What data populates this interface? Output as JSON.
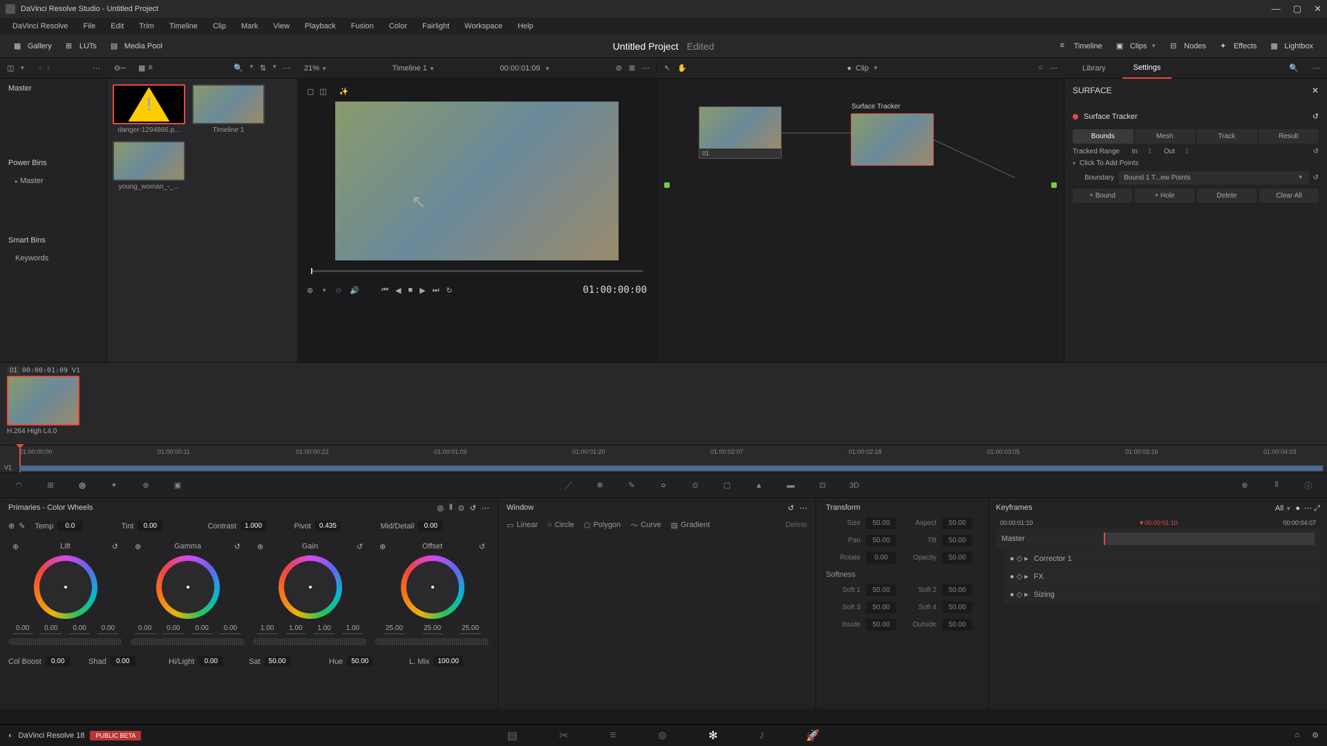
{
  "window": {
    "title": "DaVinci Resolve Studio - Untitled Project"
  },
  "menu": [
    "DaVinci Resolve",
    "File",
    "Edit",
    "Trim",
    "Timeline",
    "Clip",
    "Mark",
    "View",
    "Playback",
    "Fusion",
    "Color",
    "Fairlight",
    "Workspace",
    "Help"
  ],
  "toolbar": {
    "gallery": "Gallery",
    "luts": "LUTs",
    "mediapool": "Media Pool",
    "timeline": "Timeline",
    "clips": "Clips",
    "nodes": "Nodes",
    "effects": "Effects",
    "lightbox": "Lightbox"
  },
  "project": {
    "title": "Untitled Project",
    "status": "Edited"
  },
  "subbar": {
    "zoom": "21%",
    "timeline": "Timeline 1",
    "tc": "00:00:01:09",
    "clip": "Clip"
  },
  "sidebar": {
    "master": "Master",
    "powerbins": "Power Bins",
    "pb_master": "Master",
    "smartbins": "Smart Bins",
    "keywords": "Keywords"
  },
  "thumbs": [
    {
      "name": "danger-1294866.p...",
      "type": "warning"
    },
    {
      "name": "Timeline 1",
      "type": "clip"
    },
    {
      "name": "young_woman_-_...",
      "type": "clip"
    }
  ],
  "viewer": {
    "tc": "01:00:00:00"
  },
  "nodes": {
    "label1": "01",
    "surface_label": "Surface Tracker"
  },
  "inspector": {
    "tabs": {
      "library": "Library",
      "settings": "Settings"
    },
    "section": "SURFACE",
    "tracker": "Surface Tracker",
    "pills": [
      "Bounds",
      "Mesh",
      "Track",
      "Result"
    ],
    "tracked_range": "Tracked Range",
    "in": "In",
    "in_v": "1",
    "out": "Out",
    "out_v": "1",
    "click_points": "Click To Add Points",
    "boundary": "Boundary",
    "boundary_v": "Bound 1 T...ew Points",
    "btns": [
      "+ Bound",
      "+ Hole",
      "Delete",
      "Clear All"
    ]
  },
  "clip": {
    "id": "01",
    "tc": "00:00:01:09",
    "track": "V1",
    "codec": "H.264 High L4.0"
  },
  "ruler": [
    "01:00:00:00",
    "01:00:00:11",
    "01:00:00:22",
    "01:00:01:09",
    "01:00:01:20",
    "01:00:02:07",
    "01:00:02:18",
    "01:00:03:05",
    "01:00:03:16",
    "01:00:04:03"
  ],
  "ruler_track": "V1",
  "primaries": {
    "title": "Primaries - Color Wheels",
    "top": {
      "temp": "Temp",
      "temp_v": "0.0",
      "tint": "Tint",
      "tint_v": "0.00",
      "contrast": "Contrast",
      "contrast_v": "1.000",
      "pivot": "Pivot",
      "pivot_v": "0.435",
      "md": "Mid/Detail",
      "md_v": "0.00"
    },
    "wheels": [
      {
        "name": "Lift",
        "vals": [
          "0.00",
          "0.00",
          "0.00",
          "0.00"
        ]
      },
      {
        "name": "Gamma",
        "vals": [
          "0.00",
          "0.00",
          "0.00",
          "0.00"
        ]
      },
      {
        "name": "Gain",
        "vals": [
          "1.00",
          "1.00",
          "1.00",
          "1.00"
        ]
      },
      {
        "name": "Offset",
        "vals": [
          "25.00",
          "25.00",
          "25.00"
        ]
      }
    ],
    "bot": {
      "cb": "Col Boost",
      "cb_v": "0.00",
      "shad": "Shad",
      "shad_v": "0.00",
      "hl": "Hi/Light",
      "hl_v": "0.00",
      "sat": "Sat",
      "sat_v": "50.00",
      "hue": "Hue",
      "hue_v": "50.00",
      "lm": "L. Mix",
      "lm_v": "100.00"
    }
  },
  "window_p": {
    "title": "Window",
    "shapes": [
      "Linear",
      "Circle",
      "Polygon",
      "Curve",
      "Gradient"
    ],
    "delete": "Delete"
  },
  "transform": {
    "title": "Transform",
    "rows": [
      [
        "Size",
        "50.00",
        "Aspect",
        "50.00"
      ],
      [
        "Pan",
        "50.00",
        "Tilt",
        "50.00"
      ],
      [
        "Rotate",
        "0.00",
        "Opacity",
        "50.00"
      ]
    ],
    "soft_title": "Softness",
    "soft_rows": [
      [
        "Soft 1",
        "50.00",
        "Soft 2",
        "50.00"
      ],
      [
        "Soft 3",
        "50.00",
        "Soft 4",
        "50.00"
      ],
      [
        "Inside",
        "50.00",
        "Outside",
        "50.00"
      ]
    ]
  },
  "keyframes": {
    "title": "Keyframes",
    "all": "All",
    "tc1": "00:00:01:10",
    "tc2": "00:00:01:10",
    "tc3": "00:00:04:07",
    "master": "Master",
    "items": [
      "Corrector 1",
      "FX",
      "Sizing"
    ]
  },
  "footer": {
    "app": "DaVinci Resolve 18",
    "beta": "PUBLIC BETA"
  }
}
